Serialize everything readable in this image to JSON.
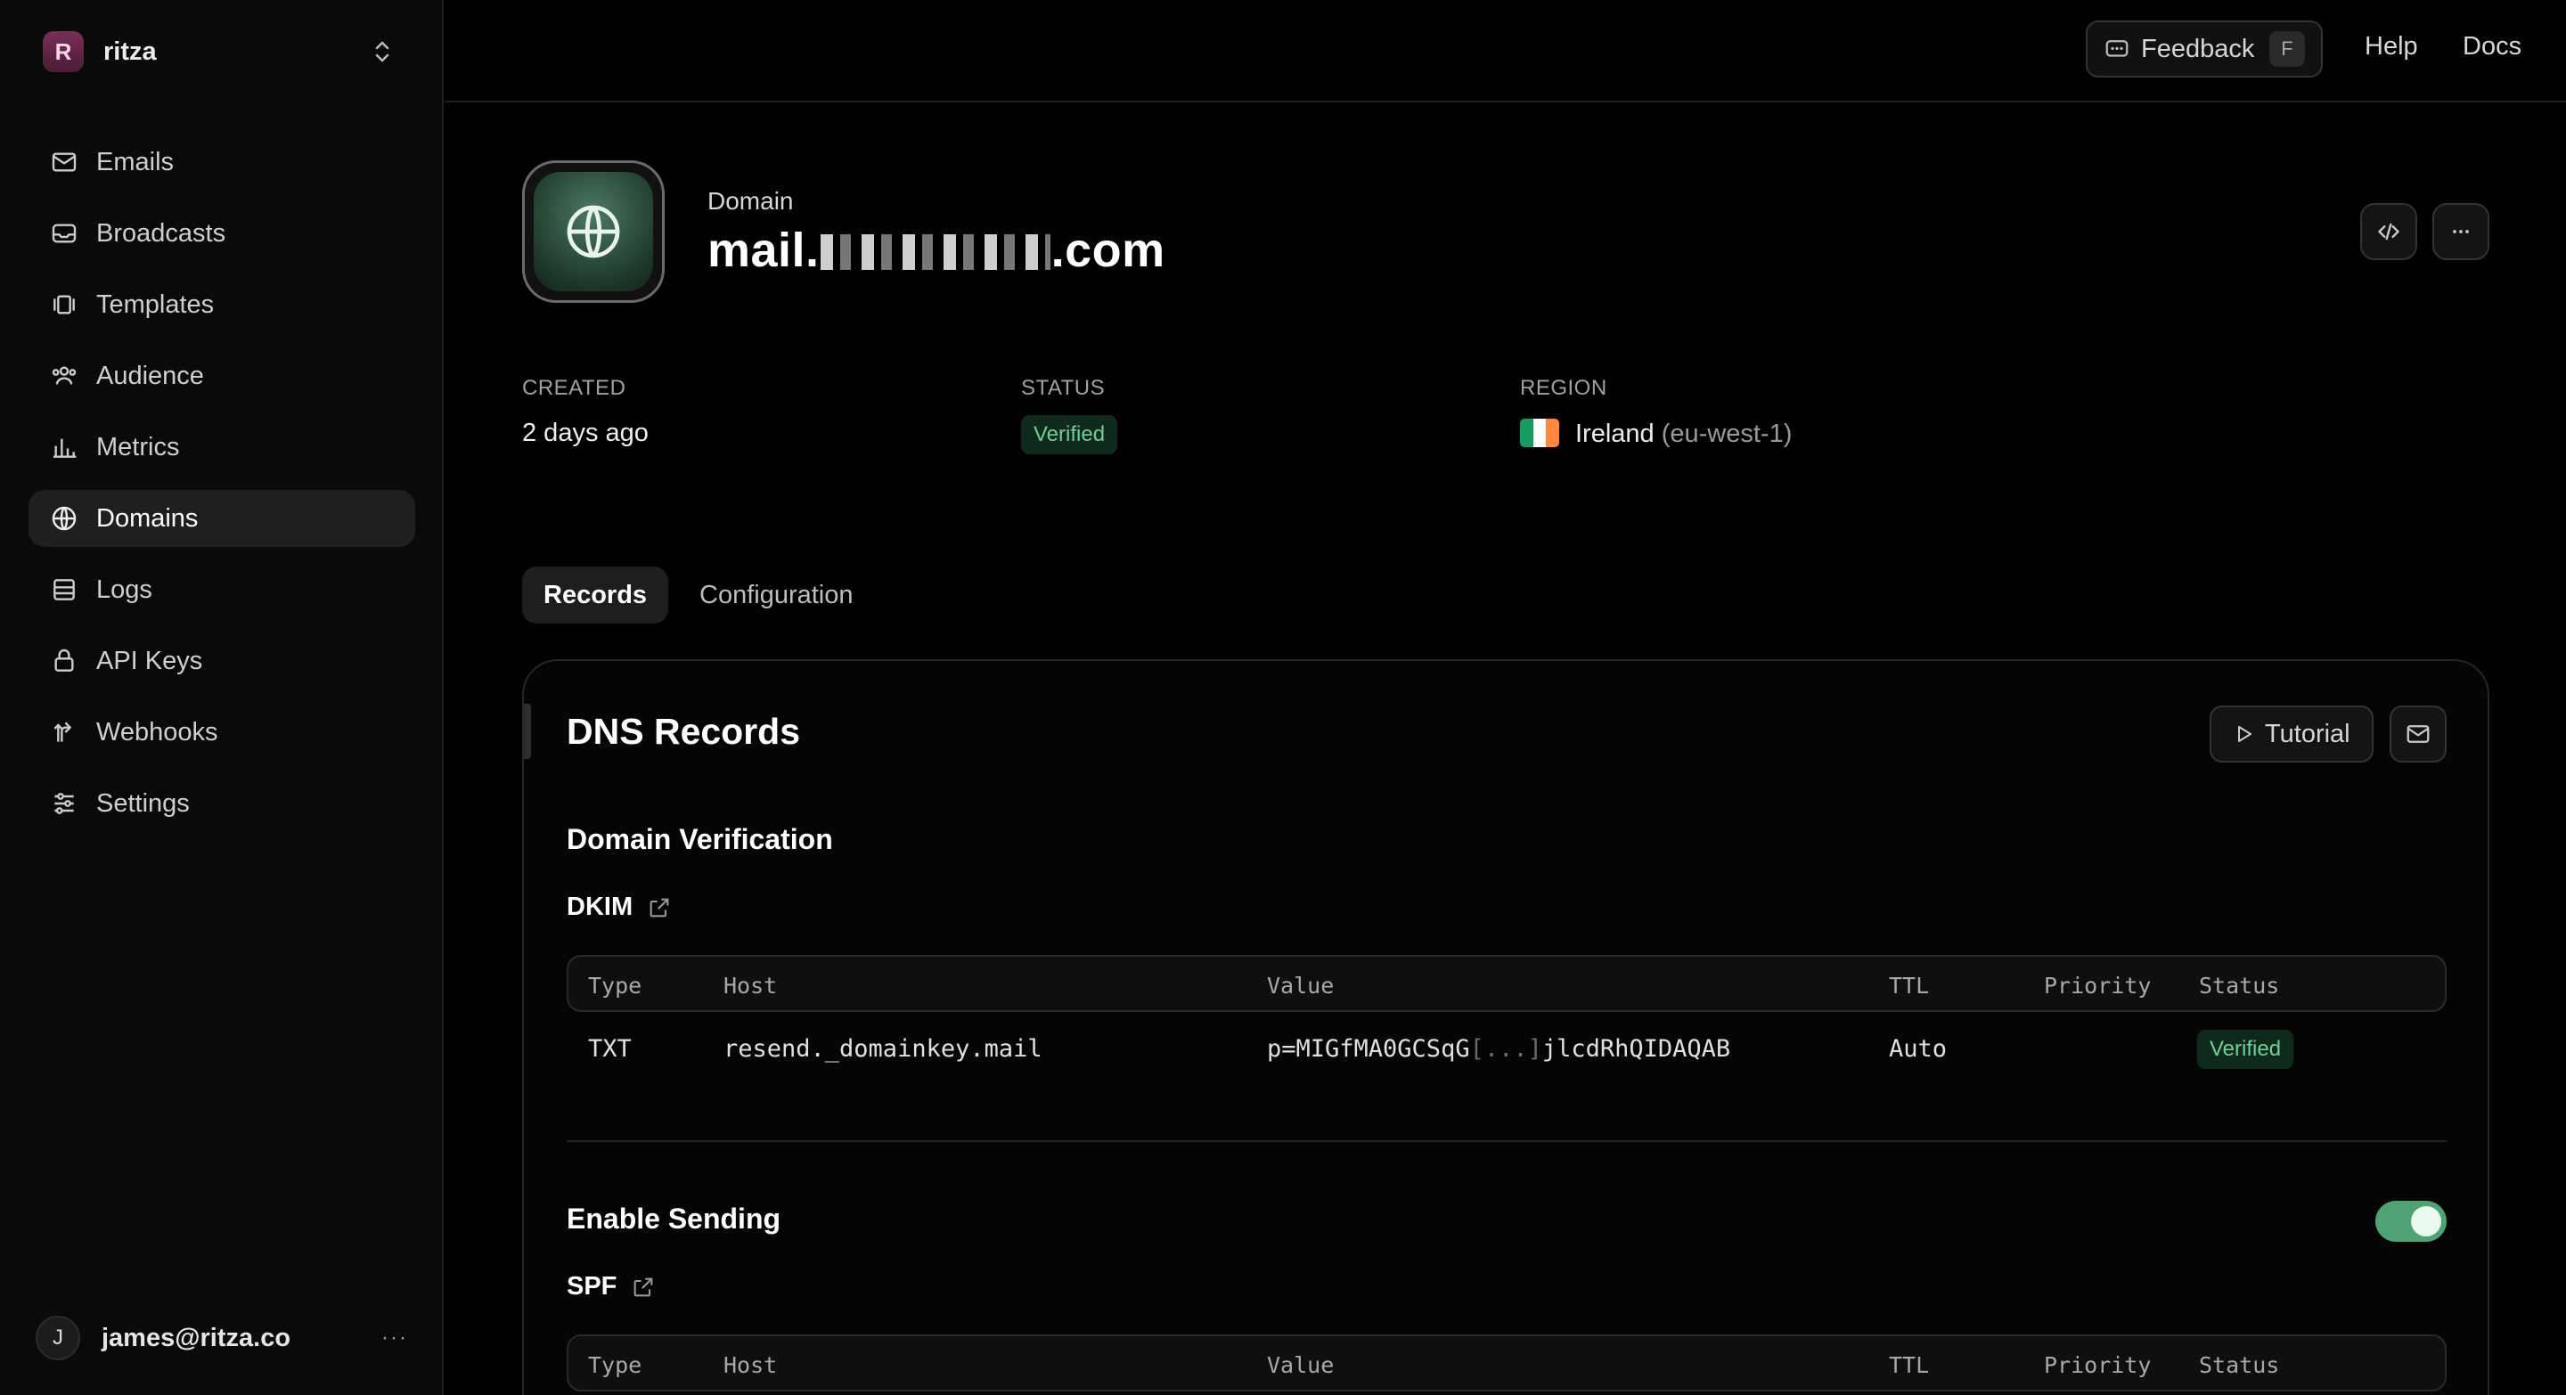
{
  "team": {
    "initial": "R",
    "name": "ritza"
  },
  "nav": [
    {
      "label": "Emails",
      "icon": "mail-icon"
    },
    {
      "label": "Broadcasts",
      "icon": "inbox-icon"
    },
    {
      "label": "Templates",
      "icon": "templates-icon"
    },
    {
      "label": "Audience",
      "icon": "users-icon"
    },
    {
      "label": "Metrics",
      "icon": "bar-chart-icon"
    },
    {
      "label": "Domains",
      "icon": "globe-icon",
      "active": true
    },
    {
      "label": "Logs",
      "icon": "list-icon"
    },
    {
      "label": "API Keys",
      "icon": "lock-icon"
    },
    {
      "label": "Webhooks",
      "icon": "webhook-icon"
    },
    {
      "label": "Settings",
      "icon": "sliders-icon"
    }
  ],
  "user": {
    "initial": "J",
    "email": "james@ritza.co",
    "more": "···"
  },
  "topbar": {
    "feedback": "Feedback",
    "feedback_key": "F",
    "help": "Help",
    "docs": "Docs"
  },
  "domain": {
    "label": "Domain",
    "name_prefix": "mail.",
    "name_suffix": ".com",
    "created_label": "CREATED",
    "created_value": "2 days ago",
    "status_label": "STATUS",
    "status_value": "Verified",
    "region_label": "REGION",
    "region_name": "Ireland",
    "region_code": "(eu-west-1)"
  },
  "tabs": [
    "Records",
    "Configuration"
  ],
  "dns": {
    "title": "DNS Records",
    "tutorial": "Tutorial",
    "verification_title": "Domain Verification",
    "dkim_label": "DKIM",
    "columns": [
      "Type",
      "Host",
      "Value",
      "TTL",
      "Priority",
      "Status"
    ],
    "dkim_row": {
      "type": "TXT",
      "host": "resend._domainkey.mail",
      "value_start": "p=MIGfMA0GCSqG",
      "value_ellipsis": "[...]",
      "value_end": "jlcdRhQIDAQAB",
      "ttl": "Auto",
      "status": "Verified"
    },
    "sending_title": "Enable Sending",
    "sending_enabled": true,
    "spf_label": "SPF"
  },
  "colors": {
    "accent_green": "#4fa274",
    "verified_text": "#6fcf97",
    "background": "#000000"
  }
}
